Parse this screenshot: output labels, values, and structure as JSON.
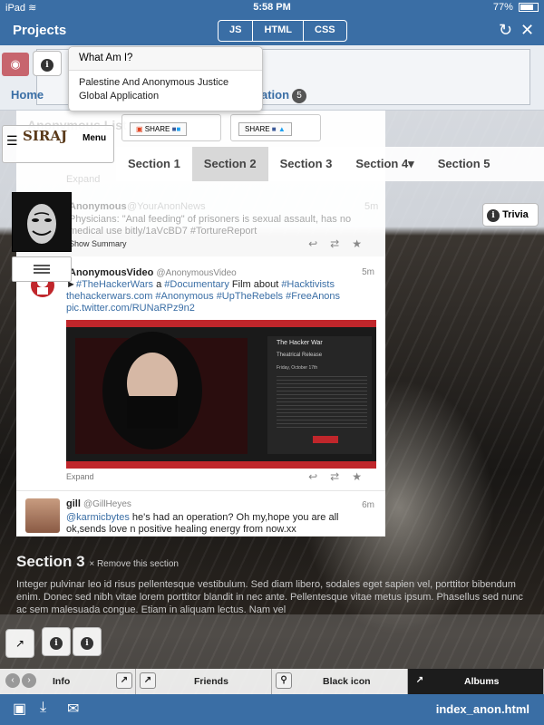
{
  "status": {
    "time": "5:58 PM",
    "left": "iPad ≋",
    "battery": "77%",
    "battery_level": 0.77
  },
  "topbar": {
    "title": "Projects",
    "tabs": [
      "JS",
      "HTML",
      "CSS"
    ],
    "refresh_icon": "refresh-icon",
    "close_icon": "close-icon"
  },
  "popover": {
    "title": "What Am I?",
    "body": "Palestine And Anonymous Justice Global Application"
  },
  "nav": {
    "home": "Home",
    "partial_link": "ation",
    "badge": "5"
  },
  "menu": {
    "label": "Menu",
    "logo_text": "SIRAJ"
  },
  "share_buttons": [
    "SHARE",
    "SHARE"
  ],
  "sections": [
    "Section 1",
    "Section 2",
    "Section 3",
    "Section 4▾",
    "Section 5"
  ],
  "active_section": "Section 2",
  "trivia": "Trivia",
  "ghost": {
    "title": "Anonymous List",
    "expand": "Expand",
    "user": "Anonymous",
    "handle": "@YourAnonNews",
    "time": "5m",
    "text": "Physicians: \"Anal feeding\" of prisoners is sexual assault, has no medical use bitly/1aVcBD7 #TortureReport",
    "summary": "Show Summary"
  },
  "tweets": [
    {
      "user": "AnonymousVideo",
      "handle": "@AnonymousVideo",
      "time": "5m",
      "text_prefix": "►",
      "link1": "#TheHackerWars",
      "mid1": " a ",
      "link2": "#Documentary",
      "mid2": " Film about ",
      "link3": "#Hacktivists",
      "line2": "thehackerwars.com #Anonymous #UpTheRebels #FreeAnons",
      "line3": "pic.twitter.com/RUNaRPz9n2",
      "media_title": "The Hacker War",
      "media_sub": "Theatrical Release",
      "media_date": "Friday, October 17th",
      "expand": "Expand"
    },
    {
      "user": "gill",
      "handle": "@GillHeyes",
      "time": "6m",
      "mention": "@karmicbytes",
      "text": " he's had an operation? Oh my,hope you are all ok,sends love n positive healing energy from now.xx"
    }
  ],
  "section3": {
    "title": "Section 3",
    "remove": "× Remove this section",
    "body": "Integer pulvinar leo id risus pellentesque vestibulum. Sed diam libero, sodales eget sapien vel, porttitor bibendum enim. Donec sed nibh vitae lorem porttitor blandit in nec ante. Pellentesque vitae metus ipsum. Phasellus sed nunc ac sem malesuada congue. Etiam in aliquam lectus. Nam vel"
  },
  "bottom_tabs": [
    "Info",
    "Friends",
    "Black icon",
    "Albums"
  ],
  "bottombar": {
    "filename": "index_anon.html"
  },
  "colors": {
    "accent": "#3a6ea5",
    "red": "#c0262b"
  }
}
